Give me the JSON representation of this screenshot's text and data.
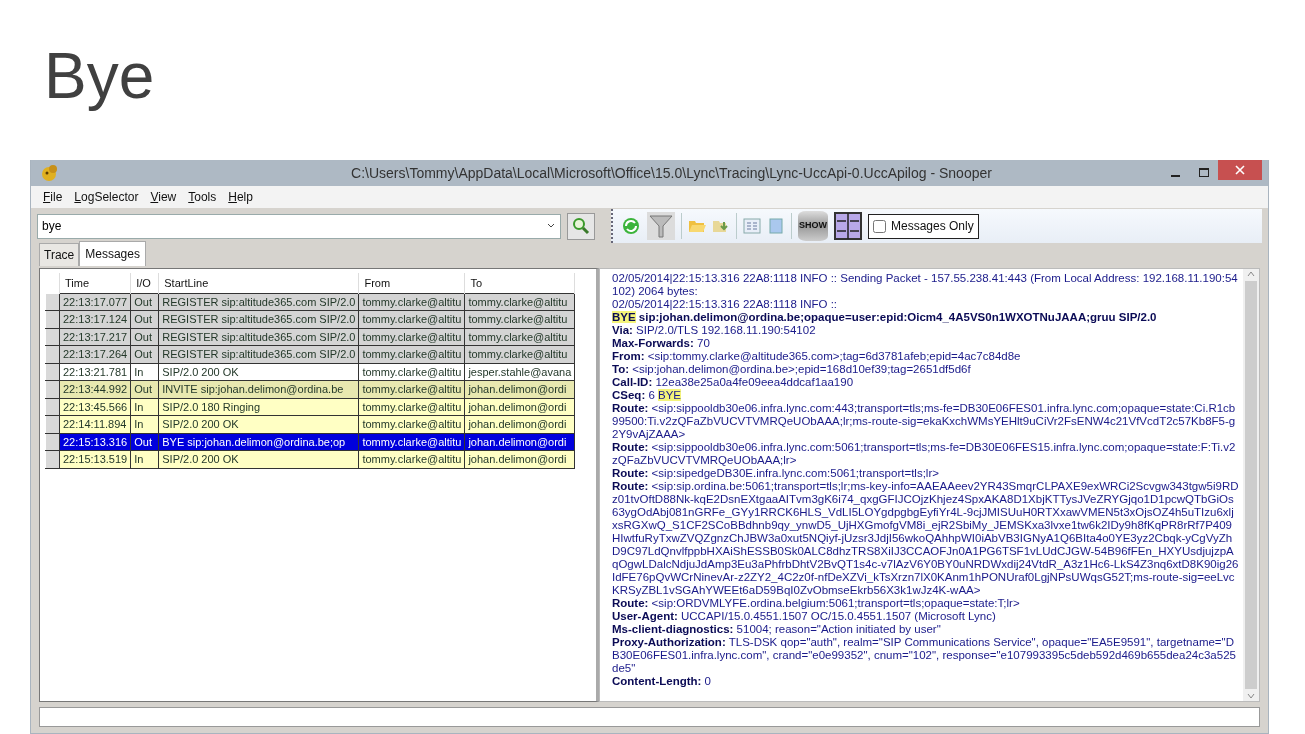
{
  "slide_title": "Bye",
  "window": {
    "title": "C:\\Users\\Tommy\\AppData\\Local\\Microsoft\\Office\\15.0\\Lync\\Tracing\\Lync-UccApi-0.UccApilog - Snooper"
  },
  "menu": [
    "File",
    "LogSelector",
    "View",
    "Tools",
    "Help"
  ],
  "search": {
    "value": "bye"
  },
  "toolbar": {
    "show_label": "SHOW",
    "messages_only": {
      "label": "Messages Only",
      "checked": false
    }
  },
  "tabs": [
    {
      "label": "Trace",
      "selected": false
    },
    {
      "label": "Messages",
      "selected": true
    }
  ],
  "table": {
    "columns": [
      "Time",
      "I/O",
      "StartLine",
      "From",
      "To"
    ],
    "rows": [
      {
        "time": "22:13:17.077",
        "io": "Out",
        "start_line": "REGISTER sip:altitude365.com SIP/2.0",
        "from": "tommy.clarke@altitu",
        "to": "tommy.clarke@altitu",
        "color": "#d4d4d4",
        "selected": false
      },
      {
        "time": "22:13:17.124",
        "io": "Out",
        "start_line": "REGISTER sip:altitude365.com SIP/2.0",
        "from": "tommy.clarke@altitu",
        "to": "tommy.clarke@altitu",
        "color": "#d4d4d4",
        "selected": false
      },
      {
        "time": "22:13:17.217",
        "io": "Out",
        "start_line": "REGISTER sip:altitude365.com SIP/2.0",
        "from": "tommy.clarke@altitu",
        "to": "tommy.clarke@altitu",
        "color": "#d4d4d4",
        "selected": false
      },
      {
        "time": "22:13:17.264",
        "io": "Out",
        "start_line": "REGISTER sip:altitude365.com SIP/2.0",
        "from": "tommy.clarke@altitu",
        "to": "tommy.clarke@altitu",
        "color": "#d4d4d4",
        "selected": false
      },
      {
        "time": "22:13:21.781",
        "io": "In",
        "start_line": "SIP/2.0 200 OK",
        "from": "tommy.clarke@altitu",
        "to": "jesper.stahle@avana",
        "color": "#ffffff",
        "selected": false
      },
      {
        "time": "22:13:44.992",
        "io": "Out",
        "start_line": "INVITE sip:johan.delimon@ordina.be",
        "from": "tommy.clarke@altitu",
        "to": "johan.delimon@ordi",
        "color": "#e8e8b0",
        "selected": false
      },
      {
        "time": "22:13:45.566",
        "io": "In",
        "start_line": "SIP/2.0 180 Ringing",
        "from": "tommy.clarke@altitu",
        "to": "johan.delimon@ordi",
        "color": "#ffffc4",
        "selected": false
      },
      {
        "time": "22:14:11.894",
        "io": "In",
        "start_line": "SIP/2.0 200 OK",
        "from": "tommy.clarke@altitu",
        "to": "johan.delimon@ordi",
        "color": "#ffffc4",
        "selected": false
      },
      {
        "time": "22:15:13.316",
        "io": "Out",
        "start_line": "BYE sip:johan.delimon@ordina.be;op",
        "from": "tommy.clarke@altitu",
        "to": "johan.delimon@ordi",
        "color": "#0000dd",
        "selected": true
      },
      {
        "time": "22:15:13.519",
        "io": "In",
        "start_line": "SIP/2.0 200 OK",
        "from": "tommy.clarke@altitu",
        "to": "johan.delimon@ordi",
        "color": "#ffffc4",
        "selected": false
      }
    ]
  },
  "message": {
    "lines": [
      [
        {
          "text": "02/05/2014|22:15:13.316 22A8:1118 INFO  :: Sending Packet - 157.55.238.41:443 (From Local Address: 192.168.11.190:54102) 2064 bytes:",
          "highlight": false
        }
      ],
      [
        {
          "text": "02/05/2014|22:15:13.316 22A8:1118 INFO  ::",
          "highlight": false
        }
      ],
      [
        {
          "text": "**BYE**",
          "highlight": true
        },
        {
          "text": " **sip:johan.delimon@ordina.be;opaque=user:epid:Oicm4_4A5VS0n1WXOTNuJAAA;gruu SIP/2.0**",
          "highlight": false
        }
      ],
      [
        {
          "text": "**Via:** SIP/2.0/TLS 192.168.11.190:54102",
          "highlight": false
        }
      ],
      [
        {
          "text": "**Max-Forwards:** 70",
          "highlight": false
        }
      ],
      [
        {
          "text": "**From:** <sip:tommy.clarke@altitude365.com>;tag=6d3781afeb;epid=4ac7c84d8e",
          "highlight": false
        }
      ],
      [
        {
          "text": "**To:** <sip:johan.delimon@ordina.be>;epid=168d10ef39;tag=2651df5d6f",
          "highlight": false
        }
      ],
      [
        {
          "text": "**Call-ID:** 12ea38e25a0a4fe09eea4ddcaf1aa190",
          "highlight": false
        }
      ],
      [
        {
          "text": "**CSeq:** 6 ",
          "highlight": false
        },
        {
          "text": "BYE",
          "highlight": true
        }
      ],
      [
        {
          "text": "**Route:** <sip:sippooldb30e06.infra.lync.com:443;transport=tls;ms-fe=DB30E06FES01.infra.lync.com;opaque=state:Ci.R1cb99500:Ti.v2zQFaZbVUCVTVMRQeUObAAA;lr;ms-route-sig=ekaKxchWMsYEHlt9uCiVr2FsENW4c21VfVcdT2c57Kb8F5-g2Y9vAjZAAA>",
          "highlight": false
        }
      ],
      [
        {
          "text": "**Route:** <sip:sippooldb30e06.infra.lync.com:5061;transport=tls;ms-fe=DB30E06FES15.infra.lync.com;opaque=state:F:Ti.v2zQFaZbVUCVTVMRQeUObAAA;lr>",
          "highlight": false
        }
      ],
      [
        {
          "text": "**Route:** <sip:sipedgeDB30E.infra.lync.com:5061;transport=tls;lr>",
          "highlight": false
        }
      ],
      [
        {
          "text": "**Route:** <sip:sip.ordina.be:5061;transport=tls;lr;ms-key-info=AAEAAeev2YR43SmqrCLPAXE9exWRCi2Scvgw343tgw5i9RDz01tvOftD88Nk-kqE2DsnEXtgaaAITvm3gK6i74_qxgGFIJCOjzKhjez4SpxAKA8D1XbjKTTysJVeZRYGjqo1D1pcwQTbGiOs63ygOdAbj081nGRFe_GYy1RRCK6HLS_VdLI5LOYgdpgbgEyfiYr4L-9cjJMISUuH0RTXxawVMEN5t3xOjsOZ4h5uTIzu6xljxsRGXwQ_S1CF2SCoBBdhnb9qy_ynwD5_UjHXGmofgVM8i_ejR2SbiMy_JEMSKxa3lvxe1tw6k2IDy9h8fKqPR8rRf7P409HIwtfuRyTxwZVQZgnzChJBW3a0xut5NQiyf-jUzsr3JdjI56wkoQAhhpWI0iAbVB3IGNyA1Q6BIta4o0YE3yz2Cbqk-yCgVyZhD9C97LdQnvlfppbHXAiShESSB0Sk0ALC8dhzTRS8XiIJ3CCAOFJn0A1PG6TSF1vLUdCJGW-54B96fFEn_HXYUsdjujzpAqOgwLDalcNdjuJdAmp3Eu3aPhfrbDhtV2BvQT1s4c-v7lAzV6Y0BY0uNRDWxdij24VtdR_A3z1Hc6-LkS4Z3nq6xtD8K90ig26IdFE76pQvWCrNinevAr-z2ZY2_4C2z0f-nfDeXZVi_kTsXrzn7lX0KAnm1hPONUraf0LgjNPsUWqsG52T;ms-route-sig=eeLvcKRSyZBL1vSGAhYWEEt6aD59BqI0ZvObmseEkrb56X3k1wJz4K-wAA>",
          "highlight": false
        }
      ],
      [
        {
          "text": "**Route:** <sip:ORDVMLYFE.ordina.belgium:5061;transport=tls;opaque=state:T;lr>",
          "highlight": false
        }
      ],
      [
        {
          "text": "**User-Agent:** UCCAPI/15.0.4551.1507 OC/15.0.4551.1507 (Microsoft Lync)",
          "highlight": false
        }
      ],
      [
        {
          "text": "**Ms-client-diagnostics:** 51004; reason=\"Action initiated by user\"",
          "highlight": false
        }
      ],
      [
        {
          "text": "**Proxy-Authorization:** TLS-DSK qop=\"auth\", realm=\"SIP Communications Service\", opaque=\"EA5E9591\", targetname=\"DB30E06FES01.infra.lync.com\", crand=\"e0e99352\", cnum=\"102\", response=\"e107993395c5deb592d469b655dea24c3a525de5\"",
          "highlight": false
        }
      ],
      [
        {
          "text": "**Content-Length:** 0",
          "highlight": false
        }
      ]
    ]
  }
}
